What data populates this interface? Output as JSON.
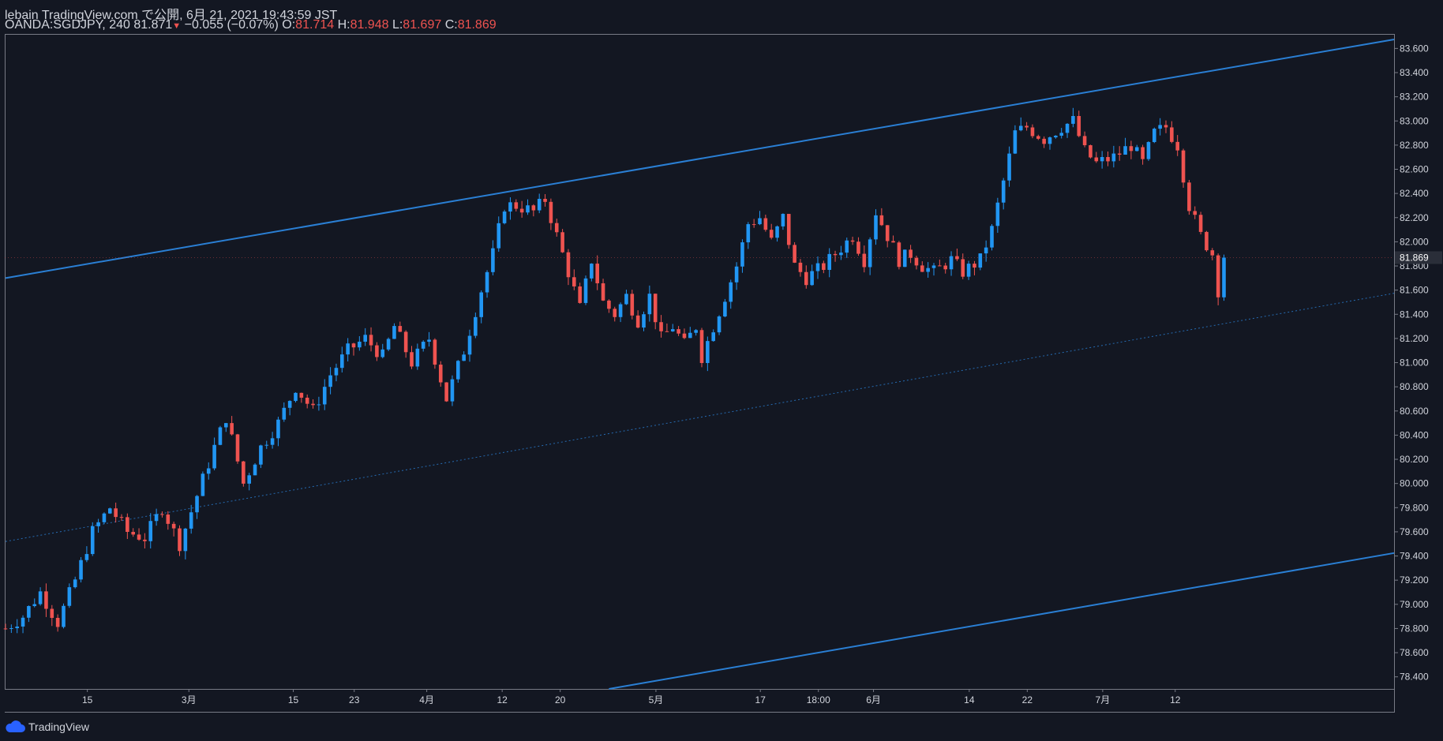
{
  "header": {
    "line1": "lebain TradingView.com で公開, 6月 21, 2021 19:43:59 JST",
    "symbol": "OANDA:SGDJPY, 240",
    "last": "81.871",
    "change": "−0.055 (−0.07%)",
    "o_label": "O:",
    "o_value": "81.714",
    "h_label": "H:",
    "h_value": "81.948",
    "l_label": "L:",
    "l_value": "81.697",
    "c_label": "C:",
    "c_value": "81.869"
  },
  "brand": {
    "label": "TradingView"
  },
  "colors": {
    "background": "#131722",
    "up": "#2196f3",
    "down": "#ef5350",
    "channel": "#2a7fd4",
    "text": "#d1d4dc",
    "border": "#787b86"
  },
  "chart_data": {
    "type": "candlestick",
    "symbol": "OANDA:SGDJPY",
    "timeframe": "240",
    "y_axis": {
      "min": 78.3,
      "max": 83.72,
      "ticks": [
        "83.600",
        "83.400",
        "83.200",
        "83.000",
        "82.800",
        "82.600",
        "82.400",
        "82.200",
        "82.000",
        "81.800",
        "81.600",
        "81.400",
        "81.200",
        "81.000",
        "80.800",
        "80.600",
        "80.400",
        "80.200",
        "80.000",
        "79.800",
        "79.600",
        "79.400",
        "79.200",
        "79.000",
        "78.800",
        "78.600",
        "78.400"
      ],
      "current_price_label": "81.869"
    },
    "x_axis": {
      "ticks": [
        "15",
        "3月",
        "15",
        "23",
        "4月",
        "12",
        "20",
        "5月",
        "17",
        "18:00",
        "6月",
        "14",
        "22",
        "7月",
        "12"
      ]
    },
    "series_path": [
      [
        0,
        78.8
      ],
      [
        3,
        78.9
      ],
      [
        6,
        79.1
      ],
      [
        9,
        78.85
      ],
      [
        12,
        79.2
      ],
      [
        15,
        79.6
      ],
      [
        18,
        79.8
      ],
      [
        21,
        79.6
      ],
      [
        24,
        79.55
      ],
      [
        27,
        79.8
      ],
      [
        30,
        79.5
      ],
      [
        33,
        79.9
      ],
      [
        36,
        80.3
      ],
      [
        38,
        80.55
      ],
      [
        41,
        80.0
      ],
      [
        44,
        80.3
      ],
      [
        47,
        80.5
      ],
      [
        50,
        80.8
      ],
      [
        53,
        80.6
      ],
      [
        56,
        80.9
      ],
      [
        59,
        81.1
      ],
      [
        62,
        81.2
      ],
      [
        65,
        81.05
      ],
      [
        67,
        81.3
      ],
      [
        70,
        81.0
      ],
      [
        73,
        81.2
      ],
      [
        76,
        80.7
      ],
      [
        79,
        81.1
      ],
      [
        82,
        81.6
      ],
      [
        84,
        81.9
      ],
      [
        86,
        82.3
      ],
      [
        88,
        82.3
      ],
      [
        91,
        82.25
      ],
      [
        93,
        82.35
      ],
      [
        95,
        82.05
      ],
      [
        97,
        81.75
      ],
      [
        99,
        81.45
      ],
      [
        101,
        81.85
      ],
      [
        103,
        81.5
      ],
      [
        105,
        81.4
      ],
      [
        107,
        81.55
      ],
      [
        109,
        81.35
      ],
      [
        111,
        81.55
      ],
      [
        113,
        81.2
      ],
      [
        115,
        81.3
      ],
      [
        117,
        81.15
      ],
      [
        119,
        81.3
      ],
      [
        120,
        81.05
      ],
      [
        122,
        81.3
      ],
      [
        124,
        81.55
      ],
      [
        126,
        81.8
      ],
      [
        128,
        82.15
      ],
      [
        130,
        82.2
      ],
      [
        132,
        82.0
      ],
      [
        134,
        82.2
      ],
      [
        136,
        81.8
      ],
      [
        138,
        81.7
      ],
      [
        141,
        81.8
      ],
      [
        144,
        81.95
      ],
      [
        146,
        82.05
      ],
      [
        148,
        81.85
      ],
      [
        150,
        82.25
      ],
      [
        152,
        82.05
      ],
      [
        154,
        81.85
      ],
      [
        156,
        81.9
      ],
      [
        158,
        81.8
      ],
      [
        160,
        81.75
      ],
      [
        163,
        81.85
      ],
      [
        165,
        81.75
      ],
      [
        168,
        81.85
      ],
      [
        170,
        82.1
      ],
      [
        172,
        82.5
      ],
      [
        174,
        82.9
      ],
      [
        176,
        82.95
      ],
      [
        179,
        82.85
      ],
      [
        182,
        82.95
      ],
      [
        184,
        83.0
      ],
      [
        186,
        82.75
      ],
      [
        188,
        82.65
      ],
      [
        191,
        82.7
      ],
      [
        194,
        82.8
      ],
      [
        196,
        82.65
      ],
      [
        198,
        82.9
      ],
      [
        200,
        82.95
      ],
      [
        202,
        82.8
      ],
      [
        204,
        82.3
      ],
      [
        206,
        82.05
      ],
      [
        208,
        81.9
      ],
      [
        209,
        81.6
      ],
      [
        210,
        81.87
      ]
    ],
    "channel": {
      "upper": [
        [
          0,
          81.7
        ],
        [
          240,
          83.68
        ]
      ],
      "lower": [
        [
          104,
          78.3
        ],
        [
          240,
          79.43
        ]
      ],
      "middle": [
        [
          0,
          79.52
        ],
        [
          240,
          81.58
        ]
      ]
    }
  }
}
